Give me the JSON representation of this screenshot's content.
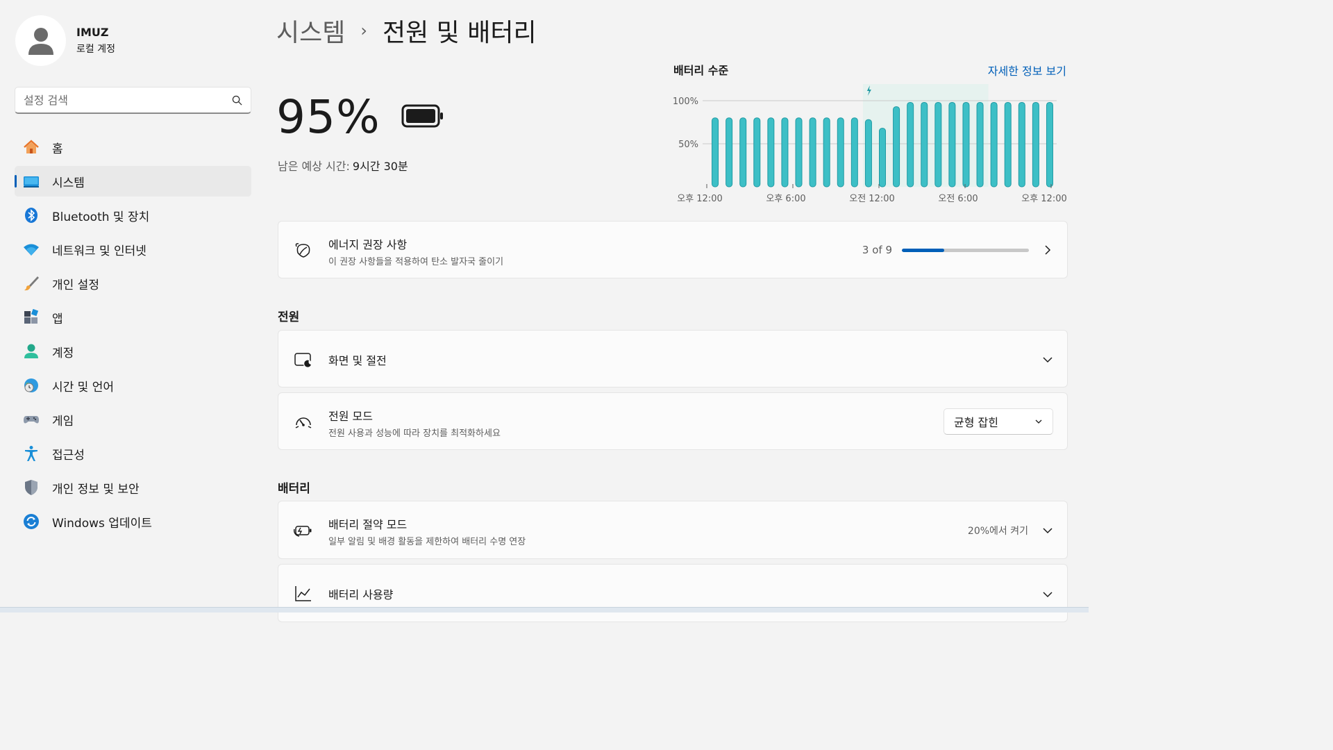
{
  "profile": {
    "name": "IMUZ",
    "subtitle": "로컬 계정"
  },
  "search": {
    "placeholder": "설정 검색"
  },
  "sidebar": {
    "items": [
      {
        "label": "홈",
        "icon": "home-icon"
      },
      {
        "label": "시스템",
        "icon": "system-icon",
        "active": true
      },
      {
        "label": "Bluetooth 및 장치",
        "icon": "bluetooth-icon"
      },
      {
        "label": "네트워크 및 인터넷",
        "icon": "wifi-icon"
      },
      {
        "label": "개인 설정",
        "icon": "brush-icon"
      },
      {
        "label": "앱",
        "icon": "apps-icon"
      },
      {
        "label": "계정",
        "icon": "account-icon"
      },
      {
        "label": "시간 및 언어",
        "icon": "globe-clock-icon"
      },
      {
        "label": "게임",
        "icon": "gamepad-icon"
      },
      {
        "label": "접근성",
        "icon": "accessibility-icon"
      },
      {
        "label": "개인 정보 및 보안",
        "icon": "shield-icon"
      },
      {
        "label": "Windows 업데이트",
        "icon": "update-icon"
      }
    ]
  },
  "breadcrumb": {
    "parent": "시스템",
    "separator": "›",
    "current": "전원 및 배터리"
  },
  "battery": {
    "percent": "95%",
    "remaining_label": "남은 예상 시간:",
    "remaining_value": "9시간 30분"
  },
  "chart_header": {
    "title": "배터리 수준",
    "link": "자세한 정보 보기"
  },
  "chart_data": {
    "type": "bar",
    "title": "배터리 수준",
    "y_ticks": [
      "100%",
      "50%"
    ],
    "x_tick_labels": [
      "오후 12:00",
      "오후 6:00",
      "오전 12:00",
      "오전 6:00",
      "오후 12:00"
    ],
    "ylim": [
      0,
      100
    ],
    "values": [
      80,
      80,
      80,
      80,
      80,
      80,
      80,
      80,
      80,
      80,
      80,
      78,
      68,
      93,
      98,
      98,
      98,
      98,
      98,
      98,
      98,
      98,
      98,
      98,
      98
    ],
    "charging_start_index": 11,
    "charging_end_index": 20,
    "bar_color": "#3dbfc6",
    "charging_band_color": "#e6f2ef"
  },
  "energy": {
    "title": "에너지 권장 사항",
    "subtitle": "이 권장 사항들을 적용하여 탄소 발자국 줄이기",
    "progress_label": "3 of 9",
    "progress_value": 0.333
  },
  "sections": {
    "power": "전원",
    "battery": "배터리"
  },
  "screen_sleep": {
    "title": "화면 및 절전"
  },
  "power_mode": {
    "title": "전원 모드",
    "subtitle": "전원 사용과 성능에 따라 장치를 최적화하세요",
    "selected": "균형 잡힌"
  },
  "battery_saver": {
    "title": "배터리 절약 모드",
    "subtitle": "일부 알림 및 배경 활동을 제한하여 배터리 수명 연장",
    "status": "20%에서 켜기"
  },
  "battery_usage": {
    "title": "배터리 사용량"
  },
  "colors": {
    "accent": "#005fb8",
    "bar": "#3dbfc6"
  }
}
